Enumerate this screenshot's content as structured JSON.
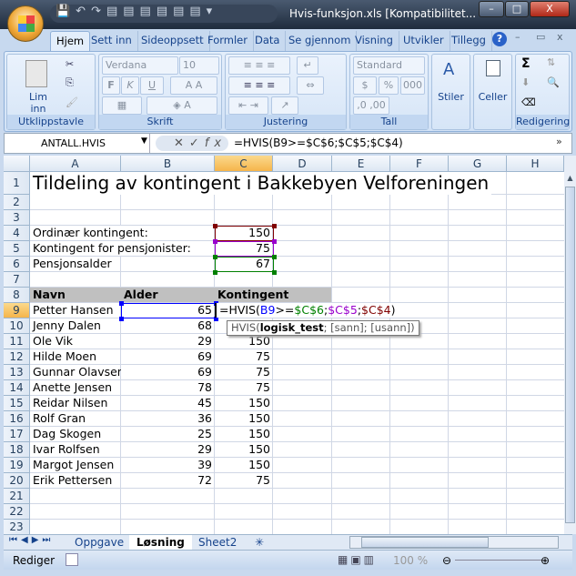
{
  "window": {
    "title": "Hvis-funksjon.xls  [Kompatibilitet...",
    "minimize": "–",
    "maximize": "□",
    "close": "X"
  },
  "ribbon_tabs": [
    "Hjem",
    "Sett inn",
    "Sideoppsett",
    "Formler",
    "Data",
    "Se gjennom",
    "Visning",
    "Utvikler",
    "Tillegg"
  ],
  "ribbon": {
    "clipboard": {
      "label": "Utklippstavle",
      "paste": "Lim inn"
    },
    "font": {
      "label": "Skrift",
      "font_name": "Verdana",
      "font_size": "10",
      "bold": "F",
      "italic": "K",
      "underline": "U"
    },
    "alignment": {
      "label": "Justering"
    },
    "number": {
      "label": "Tall",
      "format": "Standard",
      "percent": "%",
      "thousands": "000"
    },
    "styles": {
      "label": "Stiler"
    },
    "cells": {
      "label": "Celler"
    },
    "editing": {
      "label": "Redigering",
      "sum": "Σ"
    }
  },
  "formula_bar": {
    "name_box": "ANTALL.HVIS",
    "formula": "=HVIS(B9>=$C$6;$C$5;$C$4)"
  },
  "columns": [
    "A",
    "B",
    "C",
    "D",
    "E",
    "F",
    "G",
    "H"
  ],
  "selected_column": "C",
  "selected_row": 9,
  "sheet": {
    "title": "Tildeling av kontingent i Bakkebyen Velforeningen",
    "params": [
      {
        "label": "Ordinær kontingent:",
        "value": "150"
      },
      {
        "label": "Kontingent for pensjonister:",
        "value": "75"
      },
      {
        "label": "Pensjonsalder",
        "value": "67"
      }
    ],
    "headers": [
      "Navn",
      "Alder",
      "Kontingent"
    ],
    "rows": [
      {
        "name": "Petter Hansen",
        "age": "65",
        "fee": ""
      },
      {
        "name": "Jenny Dalen",
        "age": "68",
        "fee": ""
      },
      {
        "name": "Ole Vik",
        "age": "29",
        "fee": "150"
      },
      {
        "name": "Hilde Moen",
        "age": "69",
        "fee": "75"
      },
      {
        "name": "Gunnar Olavsen",
        "age": "69",
        "fee": "75"
      },
      {
        "name": "Anette Jensen",
        "age": "78",
        "fee": "75"
      },
      {
        "name": "Reidar Nilsen",
        "age": "45",
        "fee": "150"
      },
      {
        "name": "Rolf Gran",
        "age": "36",
        "fee": "150"
      },
      {
        "name": "Dag Skogen",
        "age": "25",
        "fee": "150"
      },
      {
        "name": "Ivar Rolfsen",
        "age": "29",
        "fee": "150"
      },
      {
        "name": "Margot Jensen",
        "age": "39",
        "fee": "150"
      },
      {
        "name": "Erik Pettersen",
        "age": "72",
        "fee": "75"
      }
    ],
    "editing_formula": {
      "p1": "=HVIS(",
      "p2": "B9",
      "p3": ">=",
      "p4": "$C$6",
      "p5": ";",
      "p6": "$C$5",
      "p7": ";",
      "p8": "$C$4",
      "p9": ")"
    },
    "tooltip": {
      "fn": "HVIS(",
      "arg1": "logisk_test",
      "rest": "; [sann]; [usann])"
    }
  },
  "ref_colors": {
    "b9": "#0000ff",
    "c6": "#008000",
    "c5": "#9900cc",
    "c4": "#800000"
  },
  "sheet_tabs": [
    "Oppgave",
    "Løsning",
    "Sheet2"
  ],
  "active_sheet": "Løsning",
  "status": {
    "mode": "Rediger",
    "zoom": "100 %"
  }
}
